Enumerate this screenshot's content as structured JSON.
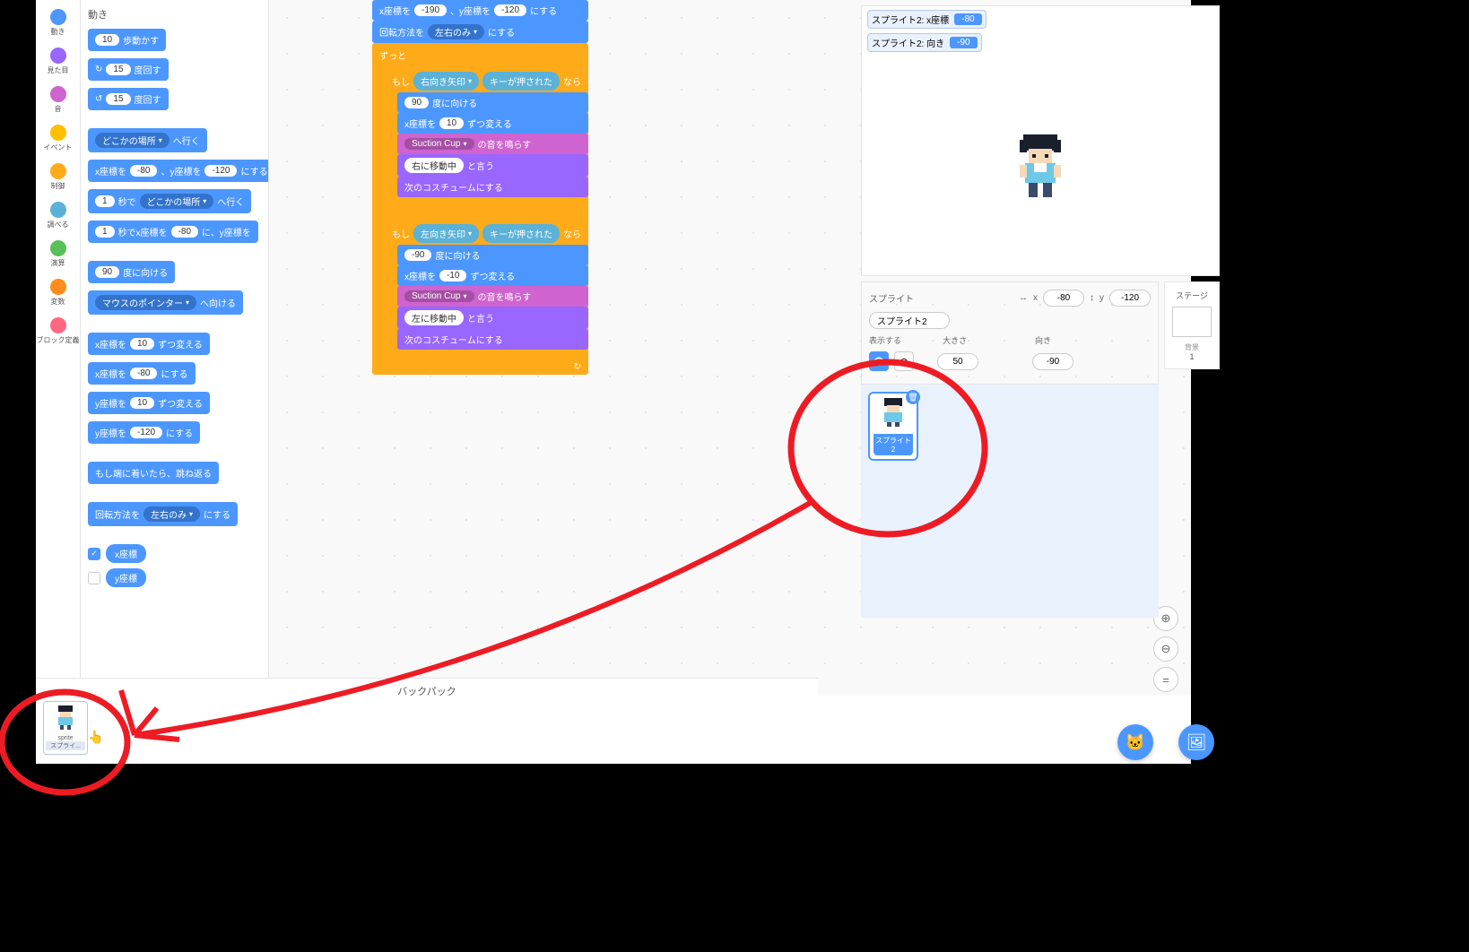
{
  "categories": [
    {
      "label": "動き",
      "color": "#4c97ff"
    },
    {
      "label": "見た目",
      "color": "#9966ff"
    },
    {
      "label": "音",
      "color": "#cf63cf"
    },
    {
      "label": "イベント",
      "color": "#ffbf00"
    },
    {
      "label": "制御",
      "color": "#ffab19"
    },
    {
      "label": "調べる",
      "color": "#5cb1d6"
    },
    {
      "label": "演算",
      "color": "#59c059"
    },
    {
      "label": "変数",
      "color": "#ff8c1a"
    },
    {
      "label": "ブロック定義",
      "color": "#ff6680"
    }
  ],
  "palette": {
    "header": "動き",
    "blocks": {
      "move_steps": {
        "text1": "歩動かす",
        "val": "10"
      },
      "turn_cw": {
        "text1": "度回す",
        "val": "15"
      },
      "turn_ccw": {
        "text1": "度回す",
        "val": "15"
      },
      "goto": {
        "text1": "へ行く",
        "dd": "どこかの場所"
      },
      "goto_xy": {
        "p1": "x座標を",
        "v1": "-80",
        "p2": "、y座標を",
        "v2": "-120",
        "p3": "にする"
      },
      "glide": {
        "v1": "1",
        "p1": "秒で",
        "dd": "どこかの場所",
        "p2": "へ行く"
      },
      "glide_xy": {
        "v1": "1",
        "p1": "秒でx座標を",
        "v2": "-80",
        "p2": "に、y座標を"
      },
      "point_dir": {
        "v1": "90",
        "p1": "度に向ける"
      },
      "point_towards": {
        "dd": "マウスのポインター",
        "p1": "へ向ける"
      },
      "change_x": {
        "p1": "x座標を",
        "v1": "10",
        "p2": "ずつ変える"
      },
      "set_x": {
        "p1": "x座標を",
        "v1": "-80",
        "p2": "にする"
      },
      "change_y": {
        "p1": "y座標を",
        "v1": "10",
        "p2": "ずつ変える"
      },
      "set_y": {
        "p1": "y座標を",
        "v1": "-120",
        "p2": "にする"
      },
      "bounce": {
        "p1": "もし端に着いたら、跳ね返る"
      },
      "rot_style": {
        "p1": "回転方法を",
        "dd": "左右のみ",
        "p2": "にする"
      },
      "x_pos": {
        "label": "x座標",
        "checked": true
      },
      "y_pos": {
        "label": "y座標",
        "checked": false
      }
    }
  },
  "script": {
    "goto_xy": {
      "p1": "x座標を",
      "v1": "-190",
      "p2": "、y座標を",
      "v2": "-120",
      "p3": "にする"
    },
    "rot_style": {
      "p1": "回転方法を",
      "dd": "左右のみ",
      "p2": "にする"
    },
    "forever": "ずっと",
    "if1": {
      "p1": "もし",
      "dd": "右向き矢印",
      "p2": "キーが押された",
      "p3": "なら"
    },
    "point_dir1": {
      "v1": "90",
      "p1": "度に向ける"
    },
    "change_x1": {
      "p1": "x座標を",
      "v1": "10",
      "p2": "ずつ変える"
    },
    "sound1": {
      "dd": "Suction Cup",
      "p1": "の音を鳴らす"
    },
    "say1": {
      "v1": "右に移動中",
      "p1": "と言う"
    },
    "next_costume": "次のコスチュームにする",
    "if2": {
      "p1": "もし",
      "dd": "左向き矢印",
      "p2": "キーが押された",
      "p3": "なら"
    },
    "point_dir2": {
      "v1": "-90",
      "p1": "度に向ける"
    },
    "change_x2": {
      "p1": "x座標を",
      "v1": "-10",
      "p2": "ずつ変える"
    },
    "sound2": {
      "dd": "Suction Cup",
      "p1": "の音を鳴らす"
    },
    "say2": {
      "v1": "左に移動中",
      "p1": "と言う"
    }
  },
  "monitors": {
    "m1": {
      "label": "スプライト2: x座標",
      "val": "-80"
    },
    "m2": {
      "label": "スプライト2: 向き",
      "val": "-90"
    }
  },
  "sprite_info": {
    "panel_label": "スプライト",
    "name": "スプライト2",
    "x_label": "x",
    "x": "-80",
    "y_label": "y",
    "y": "-120",
    "show_label": "表示する",
    "size_label": "大きさ",
    "size": "50",
    "dir_label": "向き",
    "dir": "-90"
  },
  "sprite_tile": {
    "name": "スプライト2"
  },
  "stage_panel": {
    "label": "ステージ",
    "backdrop_label": "背景",
    "count": "1"
  },
  "backpack": {
    "header": "バックパック"
  },
  "bp_item": {
    "type": "sprite",
    "name": "スプライ..."
  },
  "zoom": {
    "in": "+",
    "out": "−",
    "eq": "="
  }
}
